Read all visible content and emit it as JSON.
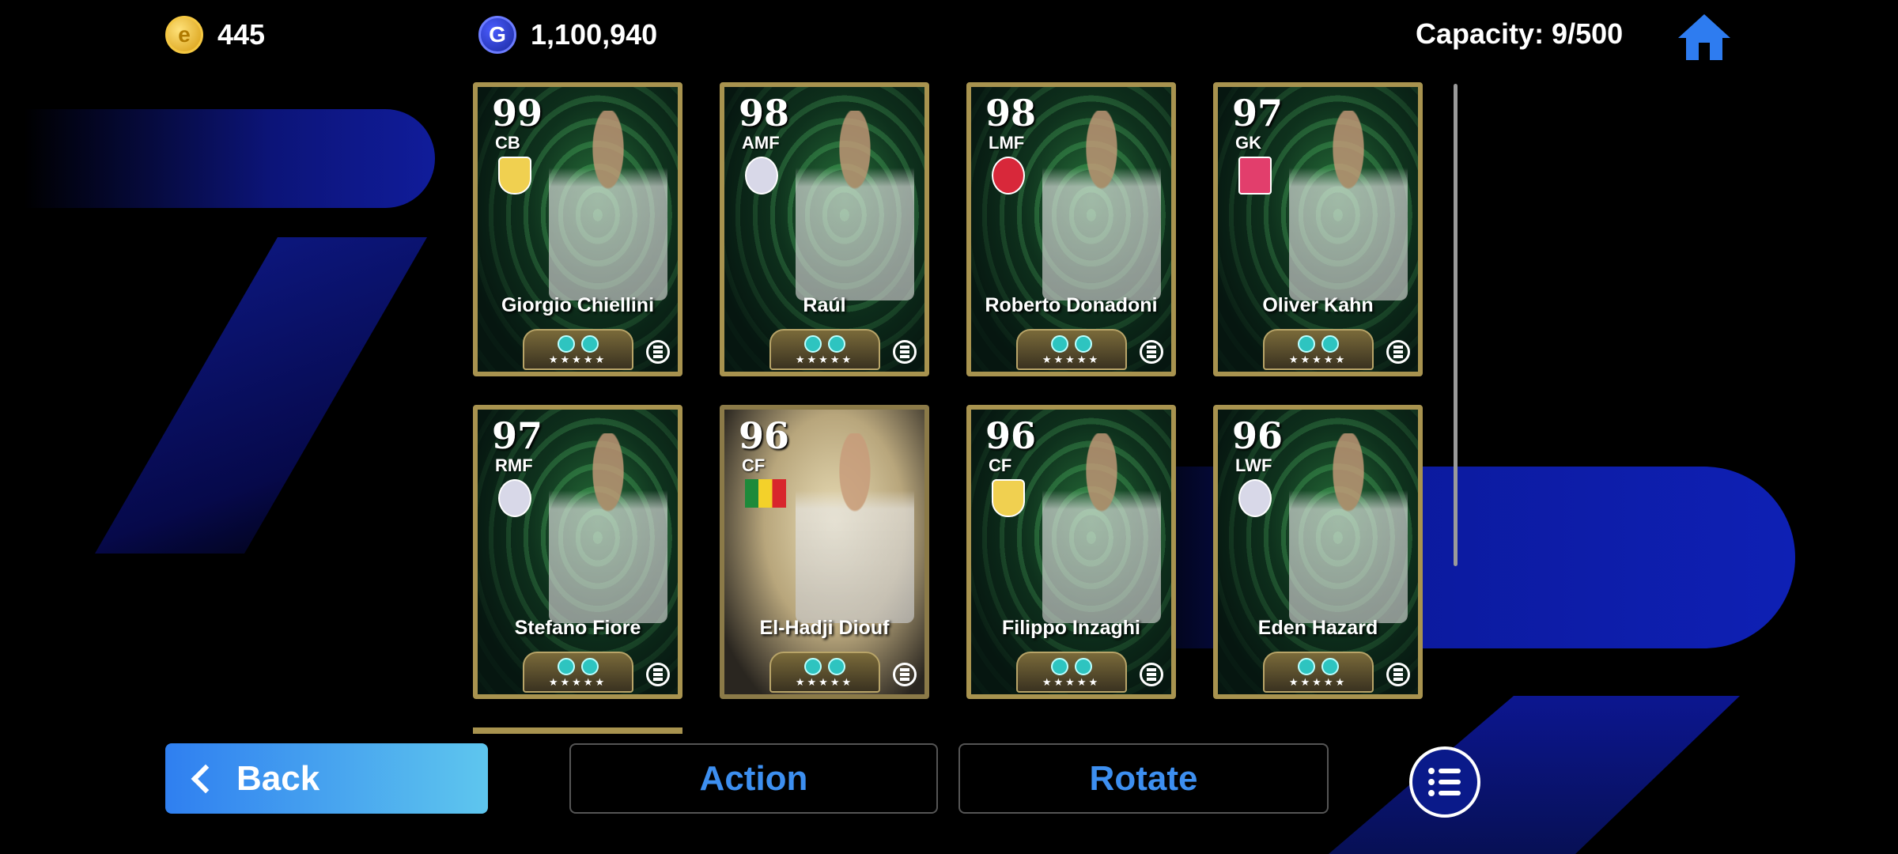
{
  "currency": {
    "coins": "445",
    "gp": "1,100,940",
    "coin_icon": "efootball-coin-icon",
    "gp_icon": "gp-icon"
  },
  "capacity": "Capacity: 9/500",
  "cards": [
    {
      "rating": "99",
      "position": "CB",
      "name": "Giorgio Chiellini",
      "badge": "club-badge"
    },
    {
      "rating": "98",
      "position": "AMF",
      "name": "Raúl",
      "badge": "club-badge"
    },
    {
      "rating": "98",
      "position": "LMF",
      "name": "Roberto Donadoni",
      "badge": "club-badge"
    },
    {
      "rating": "97",
      "position": "GK",
      "name": "Oliver Kahn",
      "badge": "club-badge"
    },
    {
      "rating": "97",
      "position": "RMF",
      "name": "Stefano Fiore",
      "badge": "club-badge"
    },
    {
      "rating": "96",
      "position": "CF",
      "name": "El-Hadji Diouf",
      "badge": "national-flag"
    },
    {
      "rating": "96",
      "position": "CF",
      "name": "Filippo Inzaghi",
      "badge": "club-badge"
    },
    {
      "rating": "96",
      "position": "LWF",
      "name": "Eden Hazard",
      "badge": "club-badge"
    }
  ],
  "buttons": {
    "back": "Back",
    "action": "Action",
    "rotate": "Rotate"
  },
  "colors": {
    "accent": "#3d8ff0",
    "back_gradient_start": "#2f7ff0",
    "back_gradient_end": "#5ec6ee",
    "card_border": "#a8934f"
  }
}
